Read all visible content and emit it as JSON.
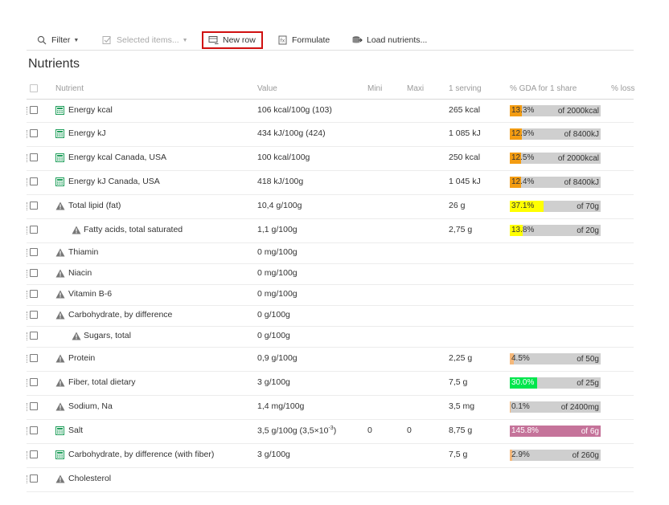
{
  "toolbar": {
    "filter_label": "Filter",
    "selected_label": "Selected items...",
    "new_row_label": "New row",
    "formulate_label": "Formulate",
    "load_label": "Load nutrients..."
  },
  "title": "Nutrients",
  "columns": {
    "nutrient": "Nutrient",
    "value": "Value",
    "mini": "Mini",
    "maxi": "Maxi",
    "serving": "1 serving",
    "gda": "% GDA for 1 share",
    "loss": "% loss"
  },
  "colors": {
    "orange": "#f39c12",
    "yellow": "#ffff00",
    "light_orange": "#f5b87a",
    "green": "#00e64d",
    "pink": "#c5739a",
    "bar_bg": "#cfcfcf",
    "icon_green": "#1e9e5a",
    "icon_gray": "#777777"
  },
  "rows": [
    {
      "icon": "calculator-icon",
      "name": "Energy kcal",
      "sub": false,
      "value": "106 kcal/100g  (103)",
      "mini": "",
      "maxi": "",
      "serving": "265 kcal",
      "gda": {
        "pct": "13.3%",
        "of": "of 2000kcal",
        "ratio": 0.133,
        "color": "#f39c12"
      }
    },
    {
      "icon": "calculator-icon",
      "name": "Energy kJ",
      "sub": false,
      "value": "434 kJ/100g  (424)",
      "mini": "",
      "maxi": "",
      "serving": "1 085 kJ",
      "gda": {
        "pct": "12.9%",
        "of": "of 8400kJ",
        "ratio": 0.129,
        "color": "#f39c12"
      }
    },
    {
      "icon": "calculator-icon",
      "name": "Energy kcal Canada, USA",
      "sub": false,
      "value": "100 kcal/100g",
      "mini": "",
      "maxi": "",
      "serving": "250 kcal",
      "gda": {
        "pct": "12.5%",
        "of": "of 2000kcal",
        "ratio": 0.125,
        "color": "#f39c12"
      }
    },
    {
      "icon": "calculator-icon",
      "name": "Energy kJ Canada, USA",
      "sub": false,
      "value": "418 kJ/100g",
      "mini": "",
      "maxi": "",
      "serving": "1 045 kJ",
      "gda": {
        "pct": "12.4%",
        "of": "of 8400kJ",
        "ratio": 0.124,
        "color": "#f39c12"
      }
    },
    {
      "icon": "warning-icon",
      "name": "Total lipid (fat)",
      "sub": false,
      "value": "10,4 g/100g",
      "mini": "",
      "maxi": "",
      "serving": "26 g",
      "gda": {
        "pct": "37.1%",
        "of": "of 70g",
        "ratio": 0.371,
        "color": "#ffff00"
      }
    },
    {
      "icon": "warning-icon",
      "name": "Fatty acids, total saturated",
      "sub": true,
      "value": "1,1 g/100g",
      "mini": "",
      "maxi": "",
      "serving": "2,75 g",
      "gda": {
        "pct": "13.8%",
        "of": "of 20g",
        "ratio": 0.138,
        "color": "#ffff00"
      }
    },
    {
      "icon": "warning-icon",
      "name": "Thiamin",
      "sub": false,
      "value": "0 mg/100g",
      "mini": "",
      "maxi": "",
      "serving": "",
      "gda": null
    },
    {
      "icon": "warning-icon",
      "name": "Niacin",
      "sub": false,
      "value": "0 mg/100g",
      "mini": "",
      "maxi": "",
      "serving": "",
      "gda": null
    },
    {
      "icon": "warning-icon",
      "name": "Vitamin B-6",
      "sub": false,
      "value": "0 mg/100g",
      "mini": "",
      "maxi": "",
      "serving": "",
      "gda": null
    },
    {
      "icon": "warning-icon",
      "name": "Carbohydrate, by difference",
      "sub": false,
      "value": "0 g/100g",
      "mini": "",
      "maxi": "",
      "serving": "",
      "gda": null
    },
    {
      "icon": "warning-icon",
      "name": "Sugars, total",
      "sub": true,
      "value": "0 g/100g",
      "mini": "",
      "maxi": "",
      "serving": "",
      "gda": null
    },
    {
      "icon": "warning-icon",
      "name": "Protein",
      "sub": false,
      "value": "0,9 g/100g",
      "mini": "",
      "maxi": "",
      "serving": "2,25 g",
      "gda": {
        "pct": "4.5%",
        "of": "of 50g",
        "ratio": 0.045,
        "color": "#f5b87a"
      }
    },
    {
      "icon": "warning-icon",
      "name": "Fiber, total dietary",
      "sub": false,
      "value": "3 g/100g",
      "mini": "",
      "maxi": "",
      "serving": "7,5 g",
      "gda": {
        "pct": "30.0%",
        "of": "of 25g",
        "ratio": 0.3,
        "color": "#00e64d"
      }
    },
    {
      "icon": "warning-icon",
      "name": "Sodium, Na",
      "sub": false,
      "value": "1,4 mg/100g",
      "mini": "",
      "maxi": "",
      "serving": "3,5 mg",
      "gda": {
        "pct": "0.1%",
        "of": "of 2400mg",
        "ratio": 0.001,
        "color": "#f5b87a"
      }
    },
    {
      "icon": "calculator-icon",
      "name": "Salt",
      "sub": false,
      "value": "3,5 g/100g  (3,5×10",
      "value_sup": "-3",
      "value_tail": ")",
      "mini": "0",
      "maxi": "0",
      "serving": "8,75 g",
      "gda": {
        "pct": "145.8%",
        "of": "of 6g",
        "ratio": 1.0,
        "color": "#c5739a"
      }
    },
    {
      "icon": "calculator-icon",
      "name": "Carbohydrate, by difference (with fiber)",
      "sub": false,
      "value": "3 g/100g",
      "mini": "",
      "maxi": "",
      "serving": "7,5 g",
      "gda": {
        "pct": "2.9%",
        "of": "of 260g",
        "ratio": 0.029,
        "color": "#f5b87a"
      }
    },
    {
      "icon": "warning-icon",
      "name": "Cholesterol",
      "sub": false,
      "value": "",
      "mini": "",
      "maxi": "",
      "serving": "",
      "gda": null
    }
  ]
}
